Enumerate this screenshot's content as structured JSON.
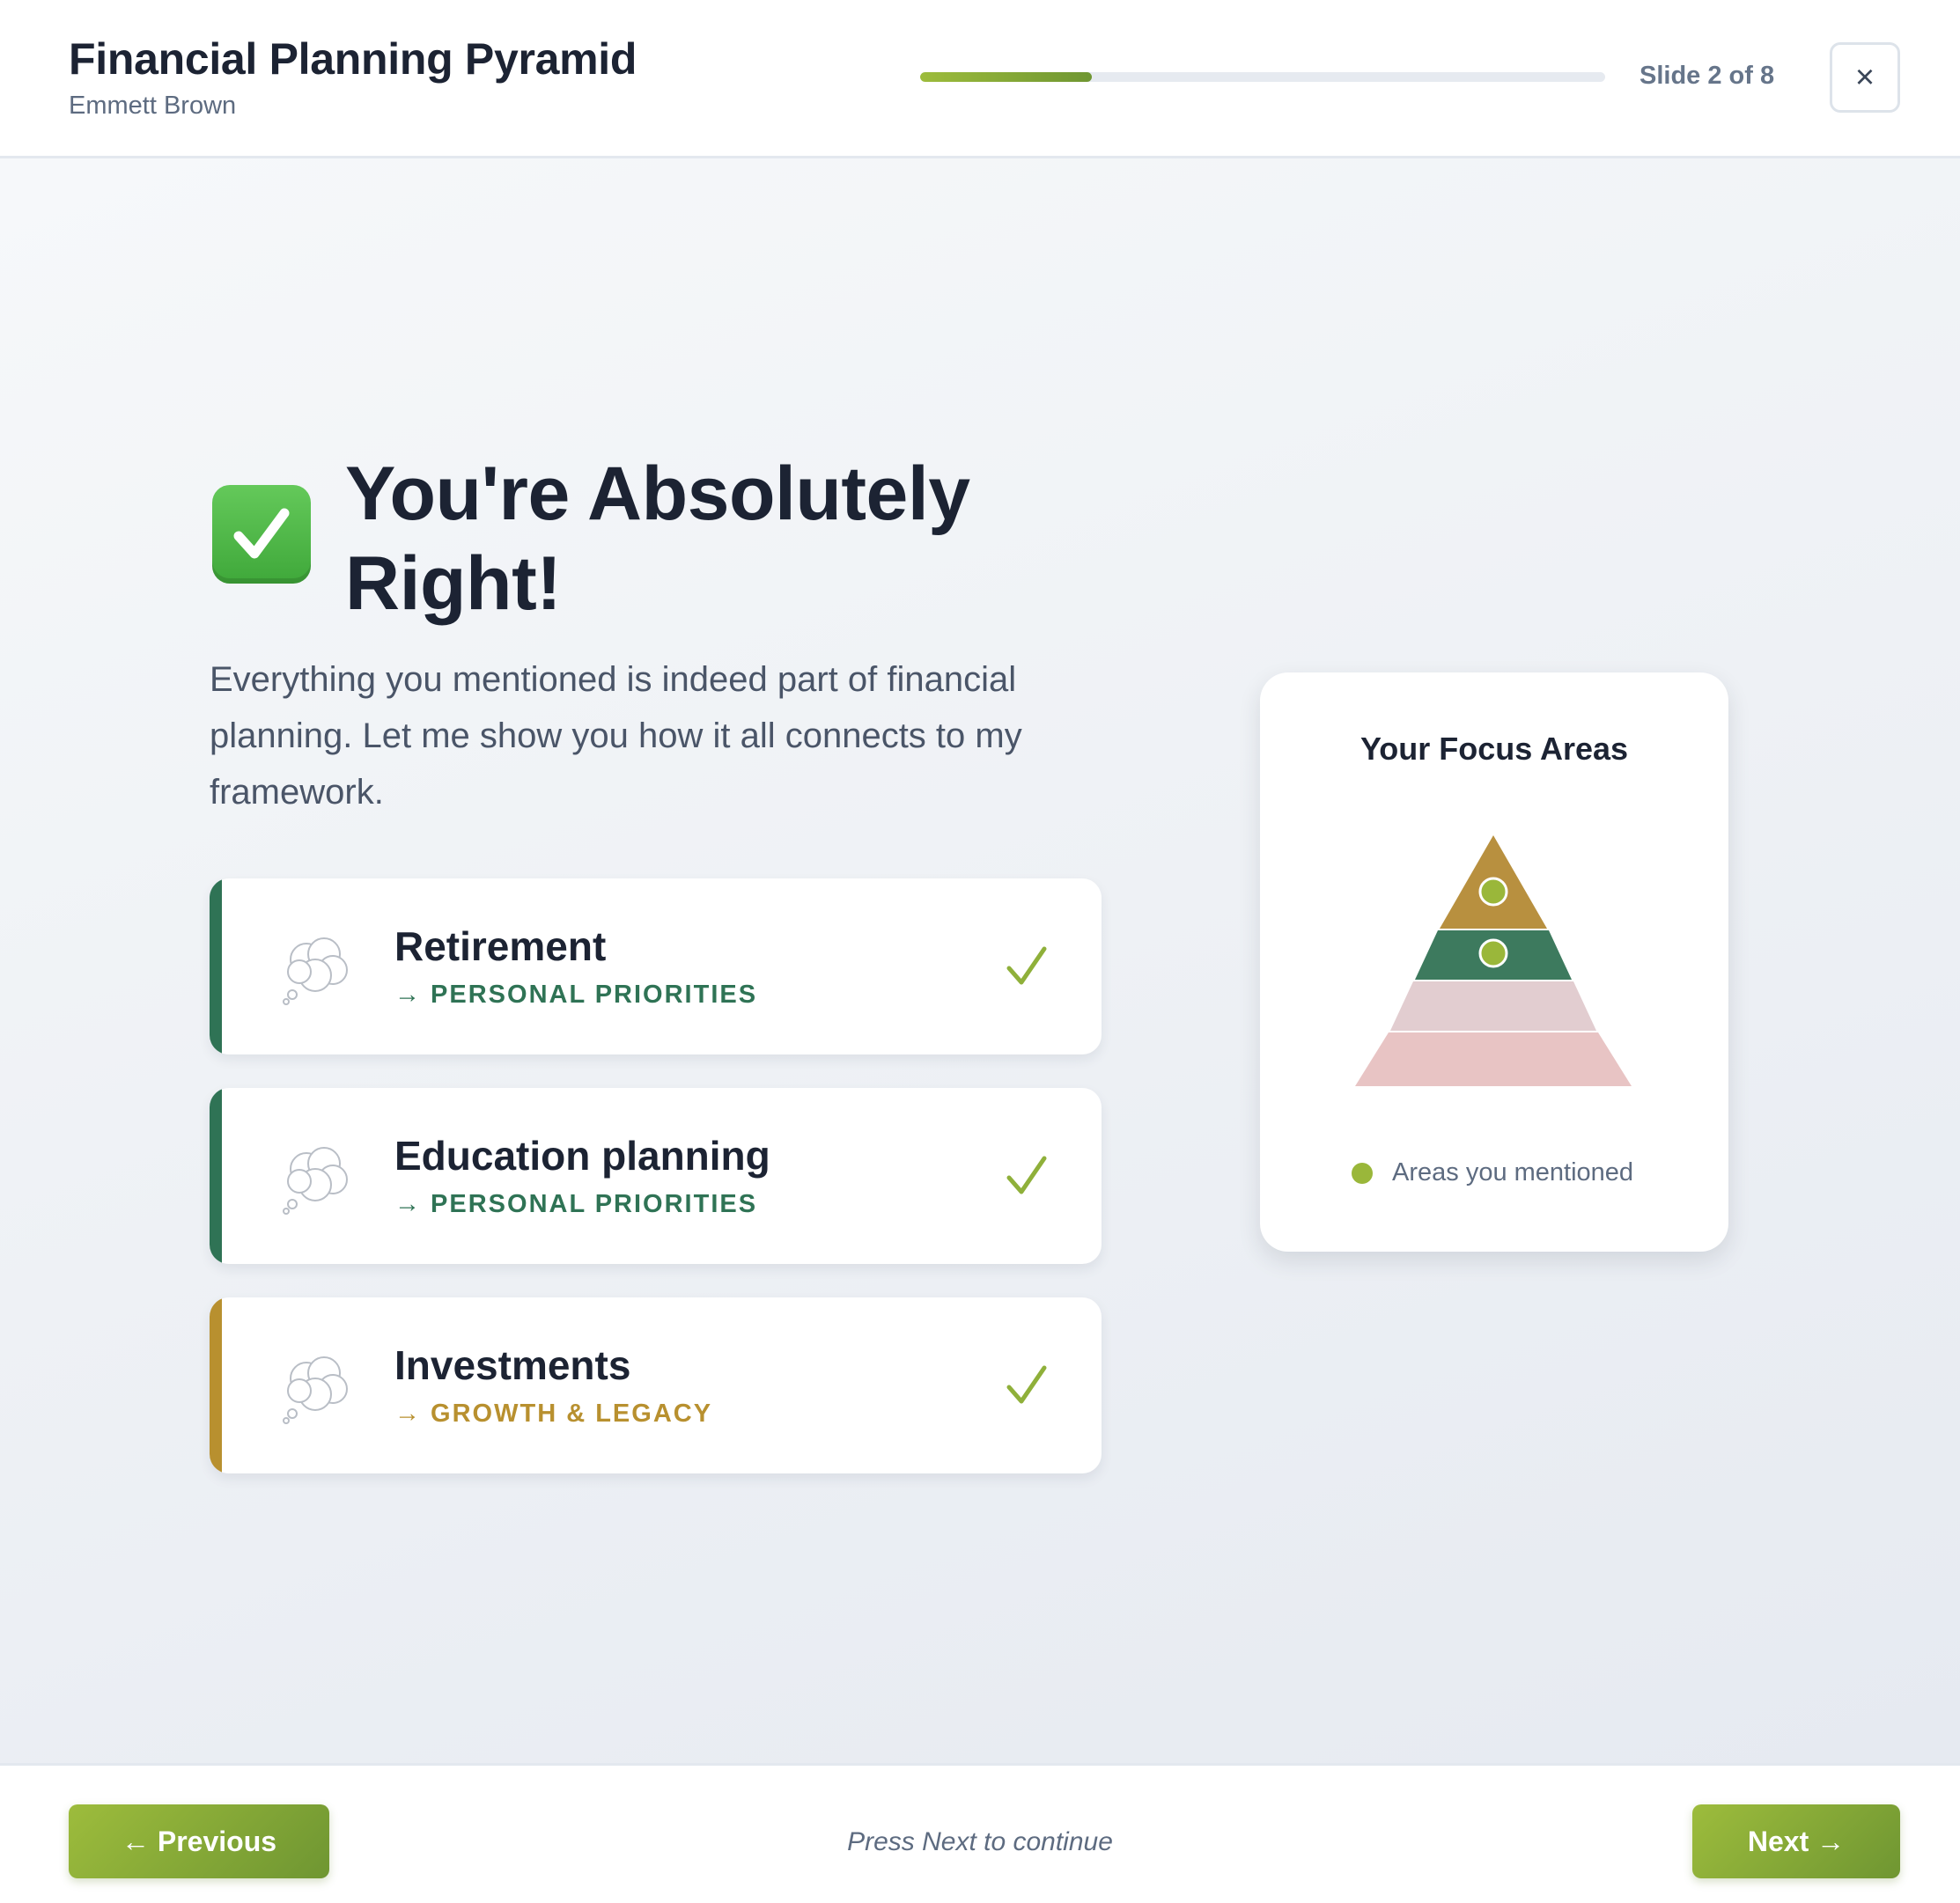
{
  "header": {
    "title": "Financial Planning Pyramid",
    "subtitle": "Emmett Brown",
    "progress": 0.25,
    "slide_counter": "Slide 2 of 8",
    "close_label": "×"
  },
  "hero": {
    "icon": "check-mark-button-emoji",
    "title": "You're Absolutely Right!",
    "description": "Everything you mentioned is indeed part of financial planning. Let me show you how it all connects to my framework."
  },
  "items": [
    {
      "title": "Retirement",
      "category": "→ PERSONAL PRIORITIES",
      "color": "#2f7355",
      "icon": "thought-balloon-icon"
    },
    {
      "title": "Education planning",
      "category": "→ PERSONAL PRIORITIES",
      "color": "#2f7355",
      "icon": "thought-balloon-icon"
    },
    {
      "title": "Investments",
      "category": "→ GROWTH & LEGACY",
      "color": "#b8902f",
      "icon": "thought-balloon-icon"
    }
  ],
  "focus_card": {
    "title": "Your Focus Areas",
    "legend": "Areas you mentioned",
    "colors": {
      "top": "#b8903f",
      "second": "#3d7a5e",
      "third": "#e2cdd0",
      "base": "#e8c4c4",
      "marker": "#9ab73a"
    }
  },
  "footer": {
    "previous_label": "← Previous",
    "hint": "Press Next to continue",
    "next_label": "Next →"
  }
}
